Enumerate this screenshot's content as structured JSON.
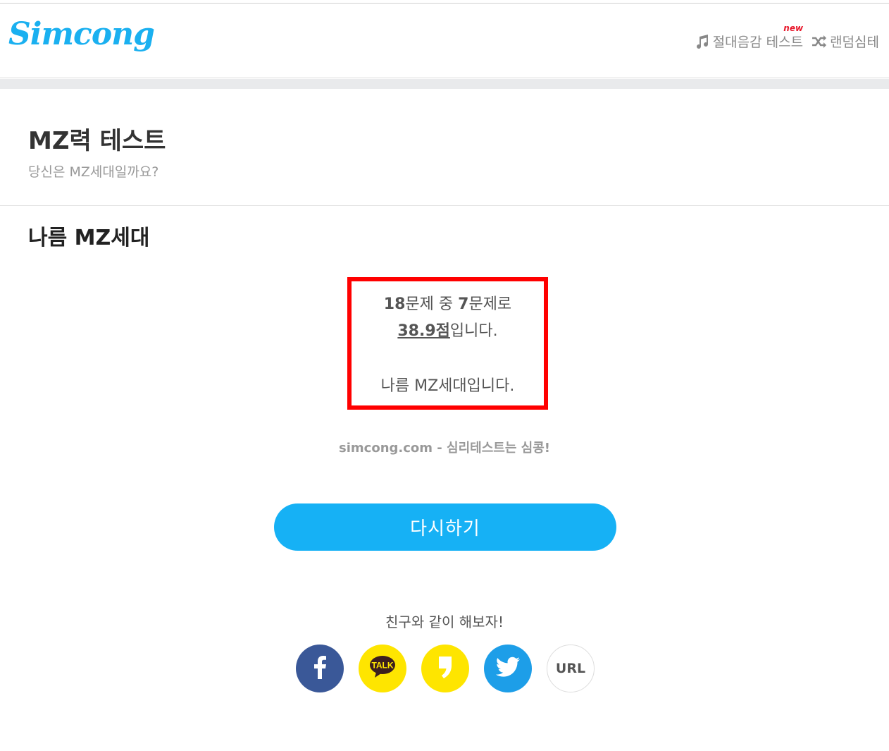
{
  "header": {
    "logo": "Simcong",
    "nav": [
      {
        "label": "절대음감 테스트",
        "badge": "new",
        "icon": "music-note-icon"
      },
      {
        "label": "랜덤심테",
        "icon": "shuffle-icon"
      }
    ]
  },
  "test": {
    "title": "MZ력 테스트",
    "subtitle": "당신은 MZ세대일까요?"
  },
  "result": {
    "heading": "나름 MZ세대",
    "total": "18",
    "total_suffix": "문제 중 ",
    "correct": "7",
    "correct_suffix": "문제로",
    "score": "38.9점",
    "score_suffix": "입니다.",
    "verdict": "나름 MZ세대입니다."
  },
  "credit": "simcong.com - 심리테스트는 심콩!",
  "retry_label": "다시하기",
  "share": {
    "label": "친구와 같이 해보자!",
    "talk_text": "TALK",
    "url_label": "URL"
  },
  "colors": {
    "brand": "#1ab0f0",
    "button": "#16b1f5",
    "highlight_border": "#ff0000",
    "facebook": "#3a5898",
    "kakao": "#fee500",
    "twitter": "#1d9ee8"
  }
}
